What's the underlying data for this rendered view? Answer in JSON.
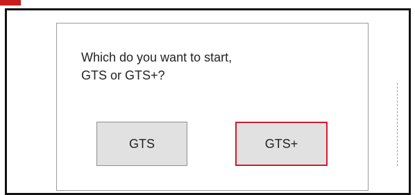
{
  "dialog": {
    "prompt_line1": "Which do you want to start,",
    "prompt_line2": "GTS or GTS+?",
    "buttons": {
      "gts": "GTS",
      "gts_plus": "GTS+"
    }
  },
  "colors": {
    "accent_red": "#d01a2c",
    "button_bg": "#e1e1e1",
    "frame_black": "#111111"
  }
}
